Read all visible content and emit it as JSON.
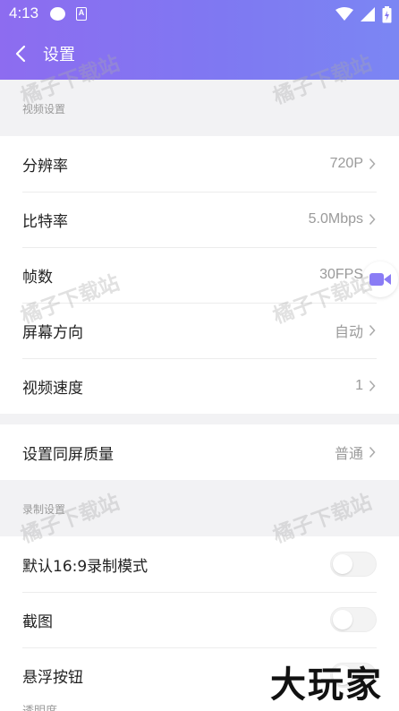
{
  "status_bar": {
    "time": "4:13",
    "a_icon_text": "A"
  },
  "header": {
    "title": "设置"
  },
  "sections": {
    "video": {
      "label": "视频设置",
      "rows": [
        {
          "label": "分辨率",
          "value": "720P"
        },
        {
          "label": "比特率",
          "value": "5.0Mbps"
        },
        {
          "label": "帧数",
          "value": "30FPS"
        },
        {
          "label": "屏幕方向",
          "value": "自动"
        },
        {
          "label": "视频速度",
          "value": "1"
        }
      ]
    },
    "screen_quality": {
      "label": "设置同屏质量",
      "value": "普通"
    },
    "record": {
      "label": "录制设置",
      "rows": [
        {
          "label": "默认16:9录制模式",
          "on": false
        },
        {
          "label": "截图",
          "on": false
        },
        {
          "label": "悬浮按钮",
          "on": false
        }
      ],
      "partial_next_label": "透明度"
    }
  },
  "watermark": {
    "text": "橘子下载站"
  },
  "brand_overlay": {
    "text": "大玩家"
  },
  "colors": {
    "header_start": "#8d6cf0",
    "header_end": "#7b86f3",
    "accent_icon": "#8a7cf5"
  }
}
